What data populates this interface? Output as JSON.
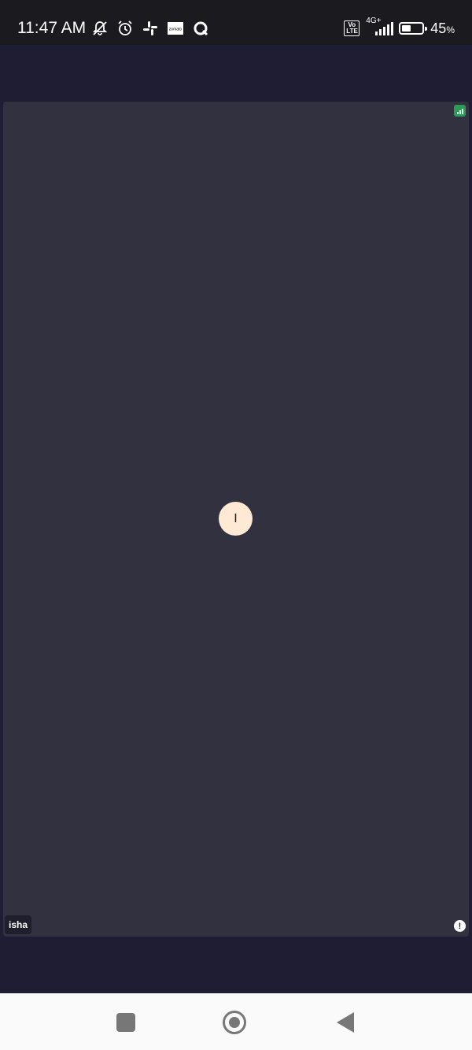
{
  "status_bar": {
    "time": "11:47 AM",
    "left_icons": [
      "mute-icon",
      "alarm-icon",
      "slack-icon",
      "zomato-icon",
      "q-app-icon"
    ],
    "zomato_label": "zomato",
    "volte_label": "Vo LTE",
    "network_type": "4G+",
    "battery_level": 0.45,
    "battery_percent": "45",
    "battery_symbol": "%"
  },
  "meeting": {
    "participant_name": "isha",
    "avatar_initial": "I",
    "connection_icon": "signal-strength-icon",
    "info_icon": "info-icon"
  },
  "nav_bar": {
    "buttons": [
      "recents-button",
      "home-button",
      "back-button"
    ]
  },
  "colors": {
    "background": "#1e1d33",
    "tile": "#32313f",
    "avatar": "#fde9d4",
    "signal_badge": "#2e9a57"
  }
}
